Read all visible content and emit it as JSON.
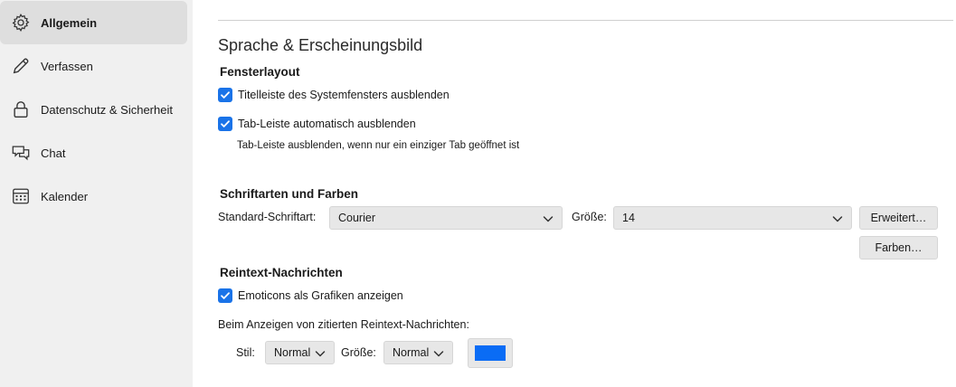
{
  "sidebar": {
    "items": [
      {
        "label": "Allgemein",
        "icon": "gear-icon",
        "active": true
      },
      {
        "label": "Verfassen",
        "icon": "pencil-icon"
      },
      {
        "label": "Datenschutz & Sicherheit",
        "icon": "lock-icon"
      },
      {
        "label": "Chat",
        "icon": "chat-bubbles-icon"
      },
      {
        "label": "Kalender",
        "icon": "calendar-icon"
      }
    ]
  },
  "main": {
    "title": "Sprache & Erscheinungsbild",
    "window_layout": {
      "heading": "Fensterlayout",
      "hide_titlebar": {
        "label": "Titelleiste des Systemfensters ausblenden",
        "checked": true
      },
      "autohide_tabbar": {
        "label": "Tab-Leiste automatisch ausblenden",
        "checked": true
      },
      "autohide_note": "Tab-Leiste ausblenden, wenn nur ein einziger Tab geöffnet ist"
    },
    "fonts_colors": {
      "heading": "Schriftarten und Farben",
      "default_font_label": "Standard-Schriftart:",
      "default_font_value": "Courier",
      "size_label": "Größe:",
      "size_value": "14",
      "advanced_button": "Erweitert…",
      "colors_button": "Farben…"
    },
    "plaintext": {
      "heading": "Reintext-Nachrichten",
      "emoticons": {
        "label": "Emoticons als Grafiken anzeigen",
        "checked": true
      },
      "quoted_label": "Beim Anzeigen von zitierten Reintext-Nachrichten:",
      "style_label": "Stil:",
      "style_value": "Normal",
      "size_label": "Größe:",
      "size_value": "Normal",
      "quote_color": "#0a6cf5"
    }
  }
}
